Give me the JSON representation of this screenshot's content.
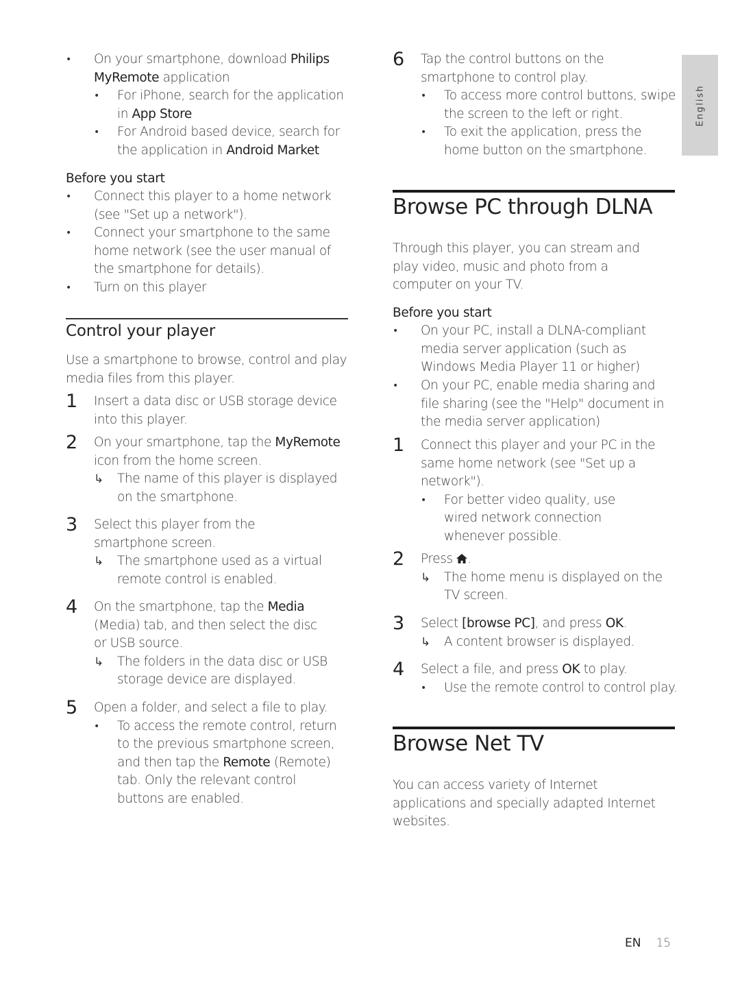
{
  "side_tab": {
    "label": "English"
  },
  "footer": {
    "lang": "EN",
    "page": "15"
  },
  "left": {
    "intro_bullet": {
      "pre": "On your smartphone, download ",
      "bold": "Philips MyRemote",
      "post": " application",
      "sub": [
        {
          "pre": "For iPhone, search for the application in ",
          "bold": "App Store"
        },
        {
          "pre": "For Android based device, search for the application in ",
          "bold": "Android Market"
        }
      ]
    },
    "before_title": "Before you start",
    "before_items": [
      "Connect this player to a home network (see \"Set up a network\").",
      "Connect your smartphone to the same home network (see the user manual of the smartphone for details).",
      "Turn on this player"
    ],
    "section_title": "Control your player",
    "section_intro": "Use a smartphone to browse, control and play media files from this player.",
    "steps": [
      {
        "n": "1",
        "text": "Insert a data disc or USB storage device into this player."
      },
      {
        "n": "2",
        "pre": "On your smartphone, tap the ",
        "bold": "MyRemote",
        "post": " icon from the home screen.",
        "result": "The name of this player is displayed on the smartphone."
      },
      {
        "n": "3",
        "text": "Select this player from the smartphone screen.",
        "result": "The smartphone used as a virtual remote control is enabled."
      },
      {
        "n": "4",
        "pre": "On the smartphone, tap the ",
        "bold": "Media",
        "post": " (Media) tab, and then select the disc or USB source.",
        "result": "The folders in the data disc or USB storage device are displayed."
      },
      {
        "n": "5",
        "text": "Open a folder, and select a file to play.",
        "bullet_pre": "To access the remote control, return to the previous smartphone screen, and then tap the ",
        "bullet_bold": "Remote",
        "bullet_post": " (Remote) tab. Only the relevant control buttons are enabled."
      }
    ]
  },
  "right": {
    "step6": {
      "n": "6",
      "text": "Tap the control buttons on the smartphone to control play.",
      "bullets": [
        "To access more control buttons, swipe the screen to the left or right.",
        "To exit the application, press the home button on the smartphone."
      ]
    },
    "dlna": {
      "title": "Browse PC through DLNA",
      "intro": "Through this player, you can stream and play video, music and photo from a computer on your TV.",
      "before_title": "Before you start",
      "before_items": [
        "On your PC, install a DLNA-compliant media server application (such as Windows Media Player 11 or higher)",
        "On your PC, enable media sharing and file sharing (see the \"Help\" document in the media server application)"
      ],
      "steps": [
        {
          "n": "1",
          "text": "Connect this player and your PC in the same home network (see \"Set up a network\").",
          "bullet": "For better video quality, use wired network connection whenever possible."
        },
        {
          "n": "2",
          "pre": "Press ",
          "icon": "home-icon",
          "post": ".",
          "result": "The home menu is displayed on the TV screen."
        },
        {
          "n": "3",
          "pre": "Select ",
          "bold": "[browse PC]",
          "mid": ", and press ",
          "bold2": "OK",
          "post": ".",
          "result": "A content browser is displayed."
        },
        {
          "n": "4",
          "pre": "Select a file, and press ",
          "bold": "OK",
          "post": " to play.",
          "bullet": "Use the remote control to control play."
        }
      ]
    },
    "nettv": {
      "title": "Browse Net TV",
      "intro": "You can access variety of Internet applications and specially adapted Internet websites."
    }
  }
}
